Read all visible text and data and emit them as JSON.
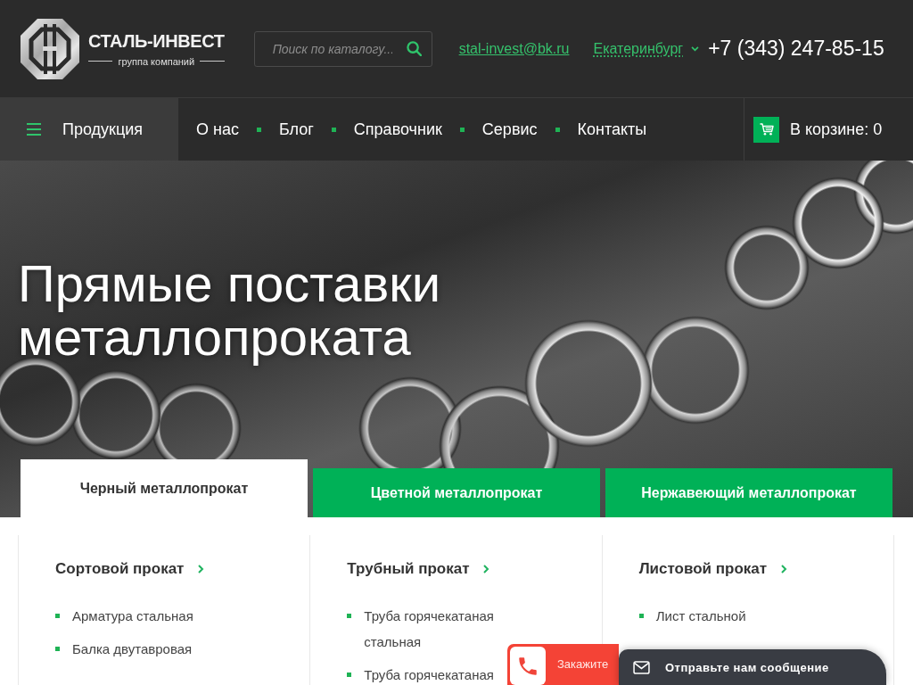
{
  "header": {
    "logo": {
      "name": "СТАЛЬ-ИНВЕСТ",
      "tagline": "группа компаний"
    },
    "search": {
      "placeholder": "Поиск по каталогу..."
    },
    "email": "stal-invest@bk.ru",
    "city": "Екатеринбург",
    "phone": "+7 (343) 247-85-15"
  },
  "nav": {
    "catalog": "Продукция",
    "items": [
      "О нас",
      "Блог",
      "Справочник",
      "Сервис",
      "Контакты"
    ],
    "cart": "В корзине: 0"
  },
  "hero": {
    "title": "Прямые поставки металлопроката"
  },
  "tabs": [
    {
      "label": "Черный металлопрокат",
      "selected": true
    },
    {
      "label": "Цветной металлопрокат",
      "selected": false
    },
    {
      "label": "Нержавеющий металлопрокат",
      "selected": false
    }
  ],
  "categories": [
    {
      "title": "Сортовой прокат",
      "items": [
        "Арматура стальная",
        "Балка двутавровая"
      ]
    },
    {
      "title": "Трубный прокат",
      "items": [
        "Труба горячекатаная стальная",
        "Труба горячекатаная"
      ]
    },
    {
      "title": "Листовой прокат",
      "items": [
        "Лист стальной"
      ]
    }
  ],
  "widgets": {
    "callback": "Закажите",
    "message": "Отправьте нам сообщение"
  }
}
